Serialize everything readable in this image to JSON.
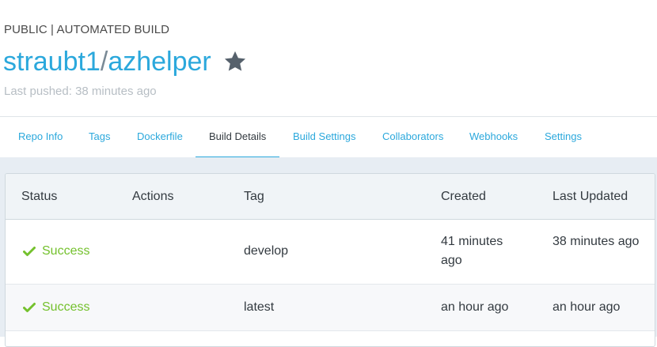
{
  "header": {
    "visibility": "PUBLIC | AUTOMATED BUILD",
    "namespace": "straubt1",
    "separator": "/",
    "repo": "azhelper",
    "last_pushed": "Last pushed: 38 minutes ago",
    "star_icon": "star-icon"
  },
  "tabs": [
    {
      "label": "Repo Info"
    },
    {
      "label": "Tags"
    },
    {
      "label": "Dockerfile"
    },
    {
      "label": "Build Details",
      "active": true
    },
    {
      "label": "Build Settings"
    },
    {
      "label": "Collaborators"
    },
    {
      "label": "Webhooks"
    },
    {
      "label": "Settings"
    }
  ],
  "table": {
    "columns": [
      "Status",
      "Actions",
      "Tag",
      "Created",
      "Last Updated"
    ],
    "rows": [
      {
        "status": "Success",
        "actions": "",
        "tag": "develop",
        "created": "41 minutes ago",
        "updated": "38 minutes ago"
      },
      {
        "status": "Success",
        "actions": "",
        "tag": "latest",
        "created": "an hour ago",
        "updated": "an hour ago"
      }
    ]
  },
  "colors": {
    "accent": "#2ba8dc",
    "success": "#74c12d",
    "star": "#56616c",
    "muted": "#b7bec4"
  }
}
